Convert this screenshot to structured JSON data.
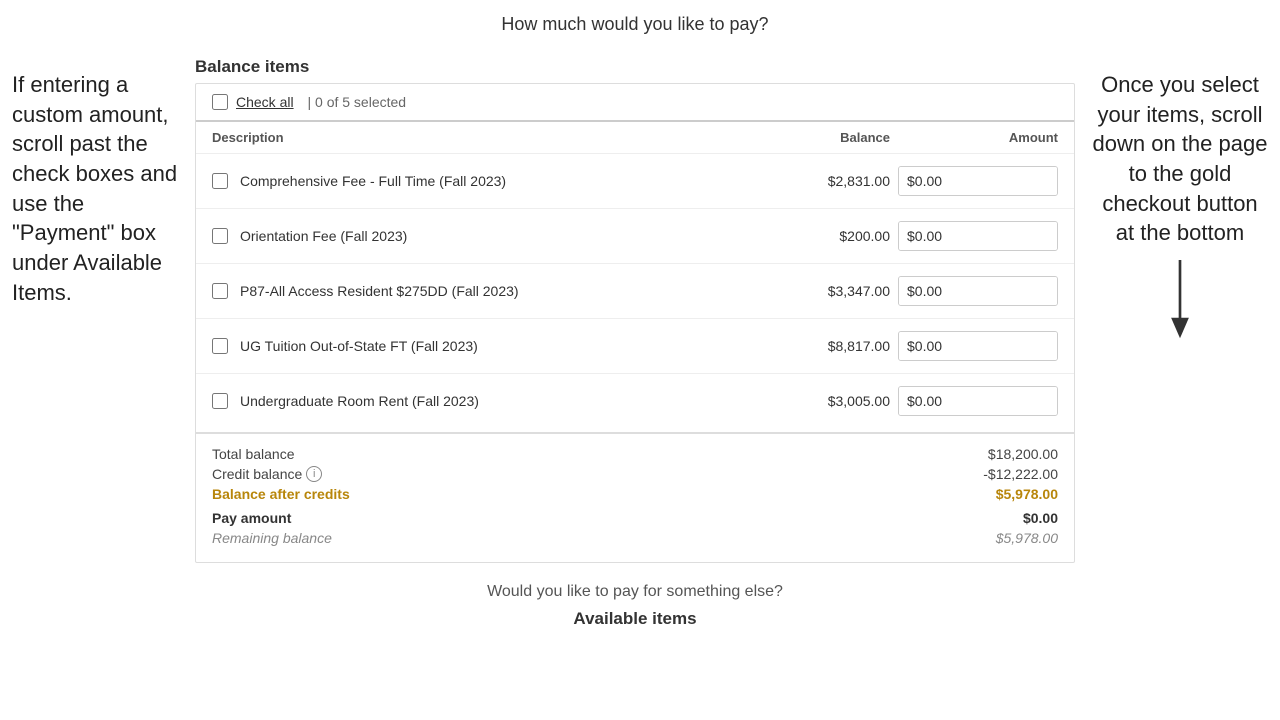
{
  "page": {
    "title": "How much would you like to pay?"
  },
  "left_instruction": {
    "text": "If entering a custom amount, scroll past the check boxes and use the \"Payment\" box under Available Items."
  },
  "right_instruction": {
    "text": "Once you select your items, scroll down on the page to the gold checkout button at the bottom"
  },
  "balance_items": {
    "section_title": "Balance items",
    "check_all_label": "Check all",
    "selected_count": "0 of 5 selected",
    "columns": {
      "description": "Description",
      "balance": "Balance",
      "amount": "Amount"
    },
    "items": [
      {
        "id": 1,
        "description": "Comprehensive Fee - Full Time (Fall 2023)",
        "balance": "$2,831.00",
        "amount": "$0.00"
      },
      {
        "id": 2,
        "description": "Orientation Fee (Fall 2023)",
        "balance": "$200.00",
        "amount": "$0.00"
      },
      {
        "id": 3,
        "description": "P87-All Access Resident $275DD (Fall 2023)",
        "balance": "$3,347.00",
        "amount": "$0.00"
      },
      {
        "id": 4,
        "description": "UG Tuition Out-of-State FT (Fall 2023)",
        "balance": "$8,817.00",
        "amount": "$0.00"
      },
      {
        "id": 5,
        "description": "Undergraduate Room Rent (Fall 2023)",
        "balance": "$3,005.00",
        "amount": "$0.00"
      }
    ],
    "summary": {
      "total_balance_label": "Total balance",
      "total_balance_value": "$18,200.00",
      "credit_balance_label": "Credit balance",
      "credit_balance_value": "-$12,222.00",
      "balance_after_credits_label": "Balance after credits",
      "balance_after_credits_value": "$5,978.00",
      "pay_amount_label": "Pay amount",
      "pay_amount_value": "$0.00",
      "remaining_balance_label": "Remaining balance",
      "remaining_balance_value": "$5,978.00"
    }
  },
  "bottom": {
    "question": "Would you like to pay for something else?",
    "available_items_label": "Available items"
  }
}
